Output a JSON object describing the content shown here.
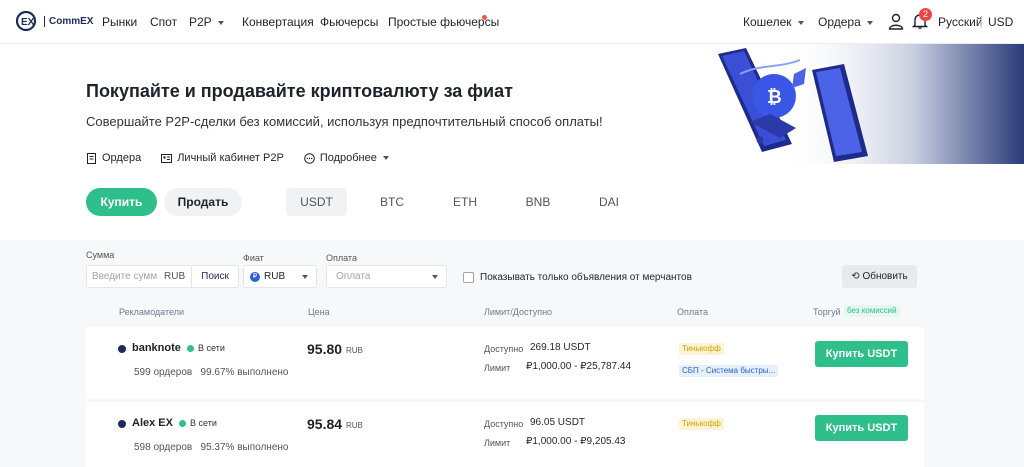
{
  "nav": {
    "logo_text": "CommEX",
    "items": [
      "Рынки",
      "Спот",
      "P2P",
      "Конвертация",
      "Фьючерсы",
      "Простые фьючерсы"
    ],
    "wallet": "Кошелек",
    "orders": "Ордера",
    "notification_count": "2",
    "language": "Русский",
    "currency": "USD"
  },
  "hero": {
    "title": "Покупайте и продавайте криптовалюту за фиат",
    "subtitle": "Совершайте P2P-сделки без комиссий, используя предпочтительный способ оплаты!",
    "links": [
      "Ордера",
      "Личный кабинет P2P",
      "Подробнее"
    ]
  },
  "trade": {
    "buy_label": "Купить",
    "sell_label": "Продать",
    "coins": [
      "USDT",
      "BTC",
      "ETH",
      "BNB",
      "DAI"
    ],
    "active_coin": "USDT"
  },
  "filters": {
    "amount_label": "Сумма",
    "amount_placeholder": "Введите сумм",
    "amount_currency": "RUB",
    "search_label": "Поиск",
    "fiat_label": "Фиат",
    "fiat_value": "RUB",
    "payment_label": "Оплата",
    "payment_placeholder": "Оплата",
    "merchant_only_label": "Показывать только объявления от мерчантов",
    "refresh_label": "Обновить"
  },
  "table": {
    "headers": [
      "Рекламодатели",
      "Цена",
      "Лимит/Доступно",
      "Оплата",
      "Торгуй"
    ],
    "fee_badge": "без комиссий",
    "available_label": "Доступно",
    "limit_label": "Лимит",
    "rows": [
      {
        "name": "banknote",
        "status": "В сети",
        "stats": "599 ордеров   99.67% выполнено",
        "price": "95.80",
        "price_currency": "RUB",
        "available": "269.18 USDT",
        "limit": "₽1,000.00 - ₽25,787.44",
        "payments": [
          "Тинькофф",
          "СБП - Система быстры..."
        ],
        "action": "Купить USDT"
      },
      {
        "name": "Alex EX",
        "status": "В сети",
        "stats": "598 ордеров   95.37% выполнено",
        "price": "95.84",
        "price_currency": "RUB",
        "available": "96.05 USDT",
        "limit": "₽1,000.00 - ₽9,205.43",
        "payments": [
          "Тинькофф"
        ],
        "action": "Купить USDT"
      }
    ]
  },
  "colors": {
    "accent_green": "#2fbf8a",
    "brand_navy": "#1e2a5a",
    "badge_red": "#f04545"
  }
}
